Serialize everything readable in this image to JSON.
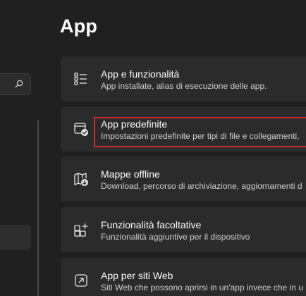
{
  "page": {
    "title": "App"
  },
  "sidebar": {
    "search_placeholder": ""
  },
  "cards": [
    {
      "icon": "apps-list-icon",
      "title": "App e funzionalità",
      "desc": "App installate, alias di esecuzione delle app."
    },
    {
      "icon": "default-apps-icon",
      "title": "App predefinite",
      "desc": "Impostazioni predefinite per tipi di file e collegamenti,"
    },
    {
      "icon": "offline-maps-icon",
      "title": "Mappe offline",
      "desc": "Download, percorso di archiviazione, aggiornamenti d"
    },
    {
      "icon": "optional-features-icon",
      "title": "Funzionalità facoltative",
      "desc": "Funzionalità aggiuntive per il dispositivo"
    },
    {
      "icon": "apps-for-websites-icon",
      "title": "App per siti Web",
      "desc": "Siti Web che possono aprirsi in un'app invece che in u"
    }
  ],
  "colors": {
    "background": "#202020",
    "card": "#2b2b2b",
    "highlight": "#d42a2a"
  }
}
